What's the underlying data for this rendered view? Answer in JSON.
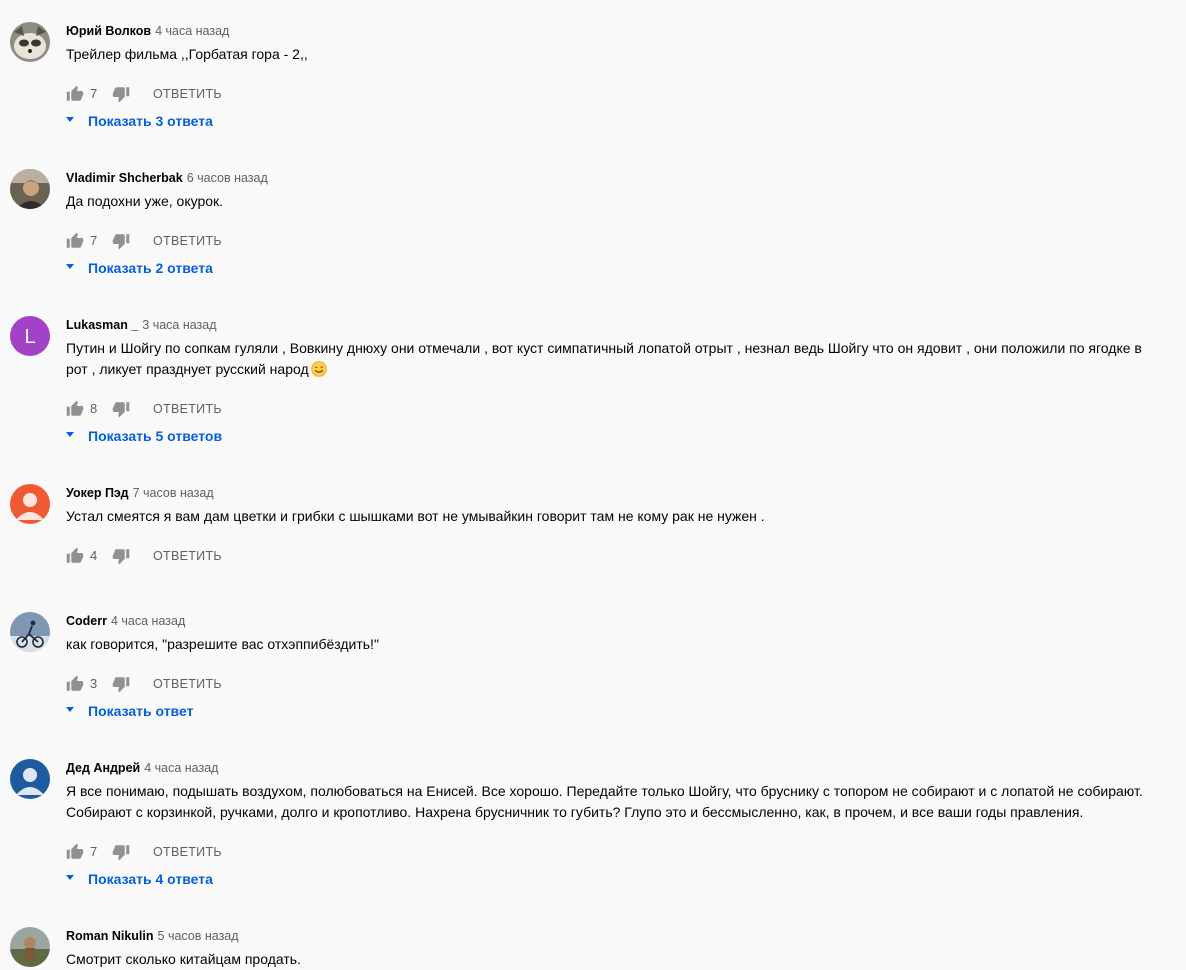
{
  "icons": {
    "like": "thumb-up-icon",
    "dislike": "thumb-down-icon",
    "expand": "caret-down-icon"
  },
  "colors": {
    "background": "#f9f9f9",
    "link": "#065fd4",
    "secondary_text": "#606060"
  },
  "comments": [
    {
      "author": "Юрий Волков",
      "time": "4 часа назад",
      "text": "Трейлер фильма ,,Горбатая гора - 2,,",
      "likes": "7",
      "reply_label": "ОТВЕТИТЬ",
      "replies_label": "Показать 3 ответа",
      "avatar": "raccoon-photo"
    },
    {
      "author": "Vladimir Shcherbak",
      "time": "6 часов назад",
      "text": "Да подохни уже, окурок.",
      "likes": "7",
      "reply_label": "ОТВЕТИТЬ",
      "replies_label": "Показать 2 ответа",
      "avatar": "person-photo"
    },
    {
      "author": "Lukasman _",
      "time": "3 часа назад",
      "text": "Путин и Шойгу по сопкам гуляли , Вовкину днюху они отмечали , вот куст симпатичный лопатой отрыт , незнал ведь Шойгу что он ядовит , они положили по ягодке в рот , ликует празднует русский народ",
      "has_emoji": true,
      "emoji": "smiling-face-emoji",
      "likes": "8",
      "reply_label": "ОТВЕТИТЬ",
      "replies_label": "Показать 5 ответов",
      "avatar": "letter",
      "avatar_letter": "L",
      "avatar_color": "#a243c7"
    },
    {
      "author": "Уокер Пэд",
      "time": "7 часов назад",
      "text": "Устал смеятся я вам дам цветки и грибки с шышками вот не умывайкин говорит там не кому рак не нужен  .",
      "likes": "4",
      "reply_label": "ОТВЕТИТЬ",
      "avatar": "default-user",
      "avatar_color": "#ef5a34"
    },
    {
      "author": "Coderr",
      "time": "4 часа назад",
      "text": "как говорится, \"разрешите вас отхэппибёздить!\"",
      "likes": "3",
      "reply_label": "ОТВЕТИТЬ",
      "replies_label": "Показать ответ",
      "avatar": "cyclist-photo"
    },
    {
      "author": "Дед Андрей",
      "time": "4 часа назад",
      "text": "Я все понимаю, подышать воздухом, полюбоваться на Енисей. Все хорошо. Передайте только Шойгу, что бруснику с топором не собирают и с лопатой не собирают. Собирают с корзинкой, ручками, долго и кропотливо. Нахрена брусничник то губить? Глупо это и бессмысленно, как, в прочем, и все ваши годы правления.",
      "likes": "7",
      "reply_label": "ОТВЕТИТЬ",
      "replies_label": "Показать 4 ответа",
      "avatar": "default-user",
      "avatar_color": "#1e5aa0"
    },
    {
      "author": "Roman Nikulin",
      "time": "5 часов назад",
      "text": "Смотрит сколько китайцам продать.",
      "avatar": "landscape-photo"
    }
  ]
}
